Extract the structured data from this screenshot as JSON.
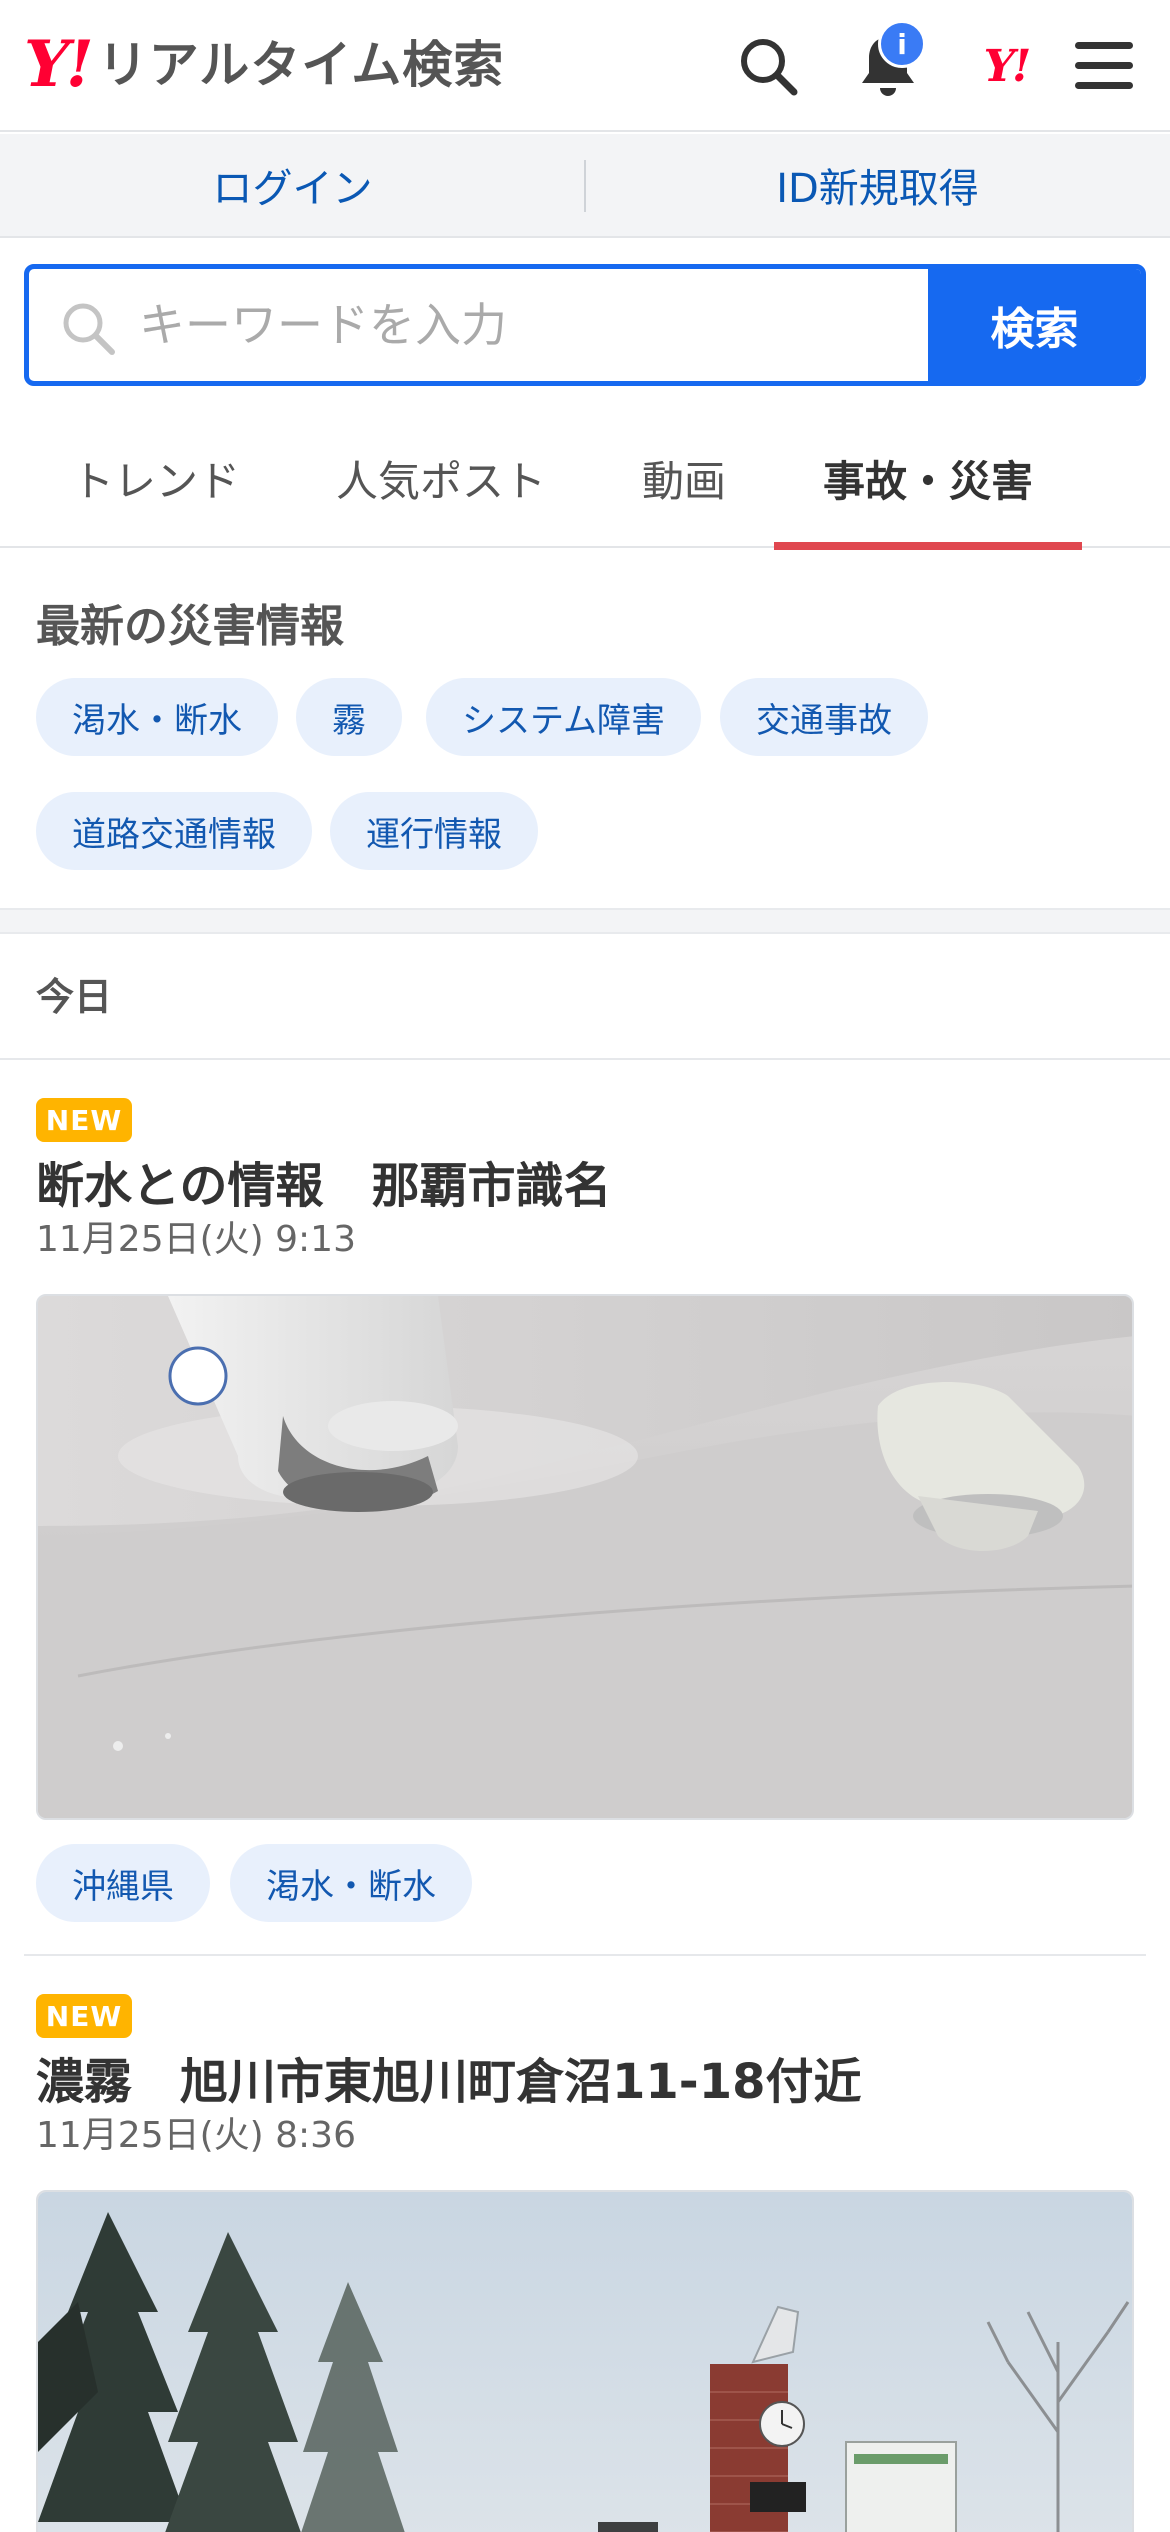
{
  "header": {
    "logo_mark": "Y!",
    "logo_text": "リアルタイム検索",
    "notification_badge": "i",
    "yahoo_mark": "Y!"
  },
  "loginbar": {
    "login": "ログイン",
    "register": "ID新規取得"
  },
  "search": {
    "placeholder": "キーワードを入力",
    "button": "検索"
  },
  "tabs": [
    {
      "label": "トレンド",
      "active": false
    },
    {
      "label": "人気ポスト",
      "active": false
    },
    {
      "label": "動画",
      "active": false
    },
    {
      "label": "事故・災害",
      "active": true
    }
  ],
  "disaster": {
    "title": "最新の災害情報",
    "chips": [
      "渇水・断水",
      "霧",
      "システム障害",
      "交通事故",
      "道路交通情報",
      "運行情報"
    ]
  },
  "date_header": "今日",
  "articles": [
    {
      "badge": "NEW",
      "title": "断水との情報　那覇市識名",
      "time": "11月25日(火) 9:13",
      "image_desc": "faucet-and-sink-photo",
      "tags": [
        "沖縄県",
        "渇水・断水"
      ]
    },
    {
      "badge": "NEW",
      "title": "濃霧　旭川市東旭川町倉沼11-18付近",
      "time": "11月25日(火) 8:36",
      "image_desc": "foggy-park-clock-tower-photo",
      "tags": []
    }
  ],
  "colors": {
    "accent_blue": "#1669f0",
    "link_blue": "#0a58b4",
    "yahoo_red": "#ff0033",
    "tab_underline": "#e0474f",
    "new_badge": "#ffb400",
    "chip_bg": "#e8f0fc"
  }
}
